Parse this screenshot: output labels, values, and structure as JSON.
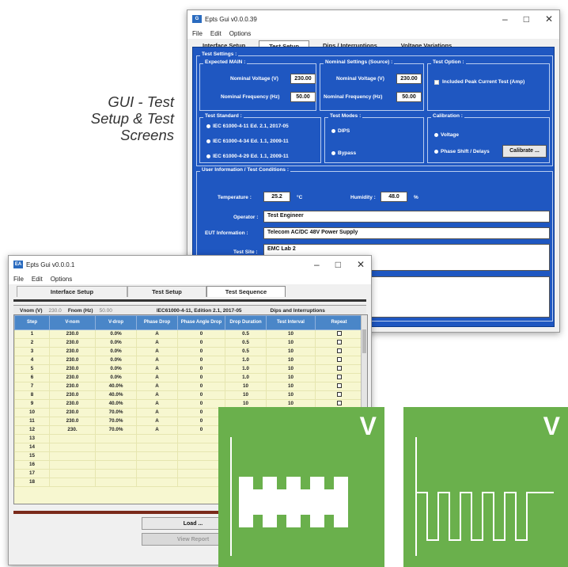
{
  "caption": [
    "GUI - Test",
    "Setup & Test",
    "Screens"
  ],
  "back_window": {
    "title": "Epts Gui v0.0.0.39",
    "menu": [
      "File",
      "Edit",
      "Options"
    ],
    "tabs": [
      "Interface Setup",
      "Test Setup",
      "Dips / Interruptions",
      "Voltage Variations"
    ],
    "selected_tab": "Test Setup",
    "test_settings_title": "Test Settings :",
    "expected_main": {
      "title": "Expected MAIN :",
      "voltage_label": "Nominal Voltage (V)",
      "voltage_value": "230.00",
      "freq_label": "Nominal Frequency (Hz)",
      "freq_value": "50.00"
    },
    "nominal_source": {
      "title": "Nominal Settings (Source) :",
      "voltage_label": "Nominal Voltage (V)",
      "voltage_value": "230.00",
      "freq_label": "Nominal Frequency (Hz)",
      "freq_value": "50.00"
    },
    "test_option": {
      "title": "Test Option :",
      "checkbox_label": "Included Peak Current Test (Amp)"
    },
    "test_standard": {
      "title": "Test Standard :",
      "options": [
        "IEC 61000-4-11 Ed. 2.1, 2017-05",
        "IEC 61000-4-34 Ed. 1.1, 2009-11",
        "IEC 61000-4-29 Ed. 1.1, 2009-11"
      ]
    },
    "test_modes": {
      "title": "Test Modes :",
      "options": [
        "DIPS",
        "Bypass"
      ]
    },
    "calibration": {
      "title": "Calibration :",
      "options": [
        "Voltage",
        "Phase Shift / Delays"
      ],
      "button": "Calibrate ..."
    },
    "user_info": {
      "title": "User Information / Test Conditions :",
      "temperature_label": "Temperature :",
      "temperature_value": "25.2",
      "temperature_unit": "°C",
      "humidity_label": "Humidity :",
      "humidity_value": "48.0",
      "humidity_unit": "%",
      "operator_label": "Operator :",
      "operator_value": "Test Engineer",
      "eut_label": "EUT Information :",
      "eut_value": "Telecom AC/DC 48V Power Supply",
      "site_label": "Test Site :",
      "site_value": "EMC Lab 2"
    }
  },
  "front_window": {
    "title": "Epts Gui v0.0.0.1",
    "menu": [
      "File",
      "Edit",
      "Options"
    ],
    "tabs": [
      "Interface Setup",
      "Test Setup",
      "Test Sequence"
    ],
    "selected_tab": "Test Sequence",
    "vnom_label": "Vnom (V)",
    "vnom_value": "230.0",
    "fnom_label": "Fnom (Hz)",
    "fnom_value": "50.00",
    "standard": "IEC61000-4-11, Edition 2.1, 2017-05",
    "mode": "Dips and Interruptions",
    "columns": [
      "Step",
      "V-nom",
      "V-drop",
      "Phase Drop",
      "Phase Angle Drop",
      "Drop Duration",
      "Test Interval",
      "Repeat"
    ],
    "rows": [
      [
        "1",
        "230.0",
        "0.0%",
        "A",
        "0",
        "0.5",
        "10"
      ],
      [
        "2",
        "230.0",
        "0.0%",
        "A",
        "0",
        "0.5",
        "10"
      ],
      [
        "3",
        "230.0",
        "0.0%",
        "A",
        "0",
        "0.5",
        "10"
      ],
      [
        "4",
        "230.0",
        "0.0%",
        "A",
        "0",
        "1.0",
        "10"
      ],
      [
        "5",
        "230.0",
        "0.0%",
        "A",
        "0",
        "1.0",
        "10"
      ],
      [
        "6",
        "230.0",
        "0.0%",
        "A",
        "0",
        "1.0",
        "10"
      ],
      [
        "7",
        "230.0",
        "40.0%",
        "A",
        "0",
        "10",
        "10"
      ],
      [
        "8",
        "230.0",
        "40.0%",
        "A",
        "0",
        "10",
        "10"
      ],
      [
        "9",
        "230.0",
        "40.0%",
        "A",
        "0",
        "10",
        "10"
      ],
      [
        "10",
        "230.0",
        "70.0%",
        "A",
        "0",
        "",
        ""
      ],
      [
        "11",
        "230.0",
        "70.0%",
        "A",
        "0",
        "",
        ""
      ],
      [
        "12",
        "230.",
        "70.0%",
        "A",
        "0",
        "",
        ""
      ],
      [
        "13",
        "",
        "",
        "",
        "",
        "",
        ""
      ],
      [
        "14",
        "",
        "",
        "",
        "",
        "",
        ""
      ],
      [
        "15",
        "",
        "",
        "",
        "",
        "",
        ""
      ],
      [
        "16",
        "",
        "",
        "",
        "",
        "",
        ""
      ],
      [
        "17",
        "",
        "",
        "",
        "",
        "",
        ""
      ],
      [
        "18",
        "",
        "",
        "",
        "",
        "",
        ""
      ]
    ],
    "repeat_rows": 9,
    "load_button": "Load ...",
    "report_button": "View Report"
  },
  "icons": [
    {
      "letter": "V",
      "name": "voltage-dips-interruptions-icon"
    },
    {
      "letter": "V",
      "name": "voltage-variations-icon"
    }
  ],
  "colors": {
    "panel_blue": "#1f57c1",
    "table_header": "#4a86c8",
    "icon_green": "#6ab04c"
  }
}
